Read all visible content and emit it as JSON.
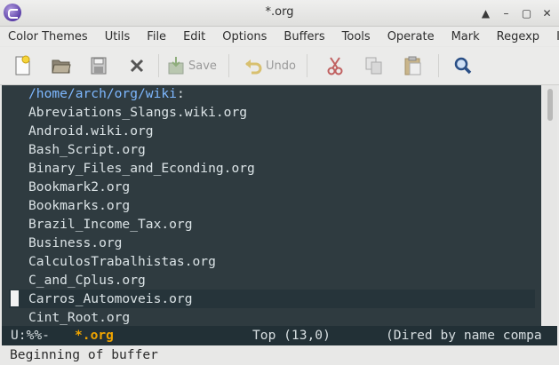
{
  "window": {
    "title": "*.org"
  },
  "menu": [
    "Color Themes",
    "Utils",
    "File",
    "Edit",
    "Options",
    "Buffers",
    "Tools",
    "Operate",
    "Mark",
    "Regexp",
    "Imm"
  ],
  "toolbar": {
    "save_label": "Save",
    "undo_label": "Undo"
  },
  "buffer": {
    "directory": "/home/arch/org/wiki",
    "directory_suffix": ":",
    "files": [
      "Abreviations_Slangs.wiki.org",
      "Android.wiki.org",
      "Bash_Script.org",
      "Binary_Files_and_Econding.org",
      "Bookmark2.org",
      "Bookmarks.org",
      "Brazil_Income_Tax.org",
      "Business.org",
      "CalculosTrabalhistas.org",
      "C_and_Cplus.org",
      "Carros_Automoveis.org",
      "Cint_Root.org"
    ],
    "current_line_index": 10
  },
  "modeline": {
    "status": "U:%%-",
    "buffer_name": "*.org",
    "position": "Top (13,0)",
    "mode": "(Dired by name compa"
  },
  "echo": {
    "message": "Beginning of buffer"
  },
  "colors": {
    "editor_bg": "#2f3b40",
    "directory": "#7eb8ff",
    "buffer_name": "#f0a400"
  },
  "icons": [
    "emacs-icon",
    "new-file-icon",
    "open-folder-icon",
    "save-disk-icon",
    "close-icon",
    "save-icon",
    "undo-icon",
    "cut-icon",
    "copy-icon",
    "paste-icon",
    "search-icon"
  ]
}
